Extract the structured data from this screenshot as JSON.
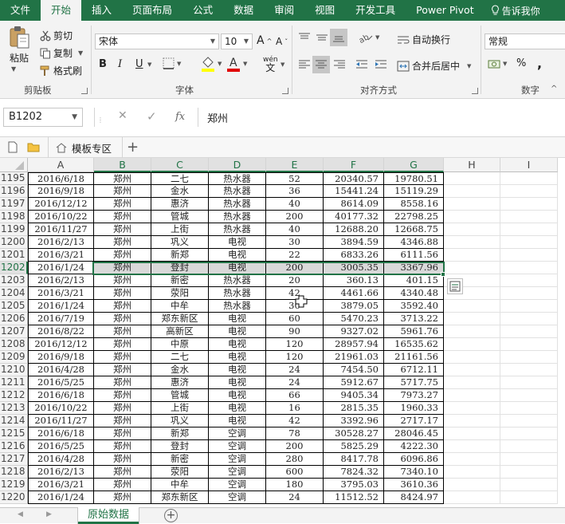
{
  "ribbon_tabs": [
    "文件",
    "开始",
    "插入",
    "页面布局",
    "公式",
    "数据",
    "审阅",
    "视图",
    "开发工具",
    "Power Pivot"
  ],
  "active_tab": "开始",
  "tell_me": "告诉我你",
  "clipboard": {
    "paste": "粘贴",
    "cut": "剪切",
    "copy": "复制",
    "format_painter": "格式刷",
    "label": "剪贴板"
  },
  "font": {
    "name": "宋体",
    "size": "10",
    "bold": "B",
    "italic": "I",
    "underline": "U",
    "wen": "wén",
    "label": "字体"
  },
  "alignment": {
    "wrap": "自动换行",
    "merge": "合并后居中",
    "label": "对齐方式"
  },
  "number": {
    "format": "常规",
    "label": "数字",
    "percent": "%",
    "comma": ","
  },
  "formula_bar": {
    "name_box": "B1202",
    "fx": "fx",
    "value": "郑州"
  },
  "tab_bar": {
    "template_label": "模板专区",
    "add": "+"
  },
  "columns": [
    "A",
    "B",
    "C",
    "D",
    "E",
    "F",
    "G",
    "H",
    "I"
  ],
  "selected_row": 1202,
  "rows": [
    {
      "n": 1195,
      "a": "2016/6/18",
      "b": "郑州",
      "c": "二七",
      "d": "热水器",
      "e": "52",
      "f": "20340.57",
      "g": "19780.51"
    },
    {
      "n": 1196,
      "a": "2016/9/18",
      "b": "郑州",
      "c": "金水",
      "d": "热水器",
      "e": "36",
      "f": "15441.24",
      "g": "15119.29"
    },
    {
      "n": 1197,
      "a": "2016/12/12",
      "b": "郑州",
      "c": "惠济",
      "d": "热水器",
      "e": "40",
      "f": "8614.09",
      "g": "8558.16"
    },
    {
      "n": 1198,
      "a": "2016/10/22",
      "b": "郑州",
      "c": "管城",
      "d": "热水器",
      "e": "200",
      "f": "40177.32",
      "g": "22798.25"
    },
    {
      "n": 1199,
      "a": "2016/11/27",
      "b": "郑州",
      "c": "上街",
      "d": "热水器",
      "e": "40",
      "f": "12688.20",
      "g": "12668.75"
    },
    {
      "n": 1200,
      "a": "2016/2/13",
      "b": "郑州",
      "c": "巩义",
      "d": "电视",
      "e": "30",
      "f": "3894.59",
      "g": "4346.88"
    },
    {
      "n": 1201,
      "a": "2016/3/21",
      "b": "郑州",
      "c": "新郑",
      "d": "电视",
      "e": "22",
      "f": "6833.26",
      "g": "6111.56"
    },
    {
      "n": 1202,
      "a": "2016/1/24",
      "b": "郑州",
      "c": "登封",
      "d": "电视",
      "e": "200",
      "f": "3005.35",
      "g": "3367.96"
    },
    {
      "n": 1203,
      "a": "2016/2/13",
      "b": "郑州",
      "c": "新密",
      "d": "热水器",
      "e": "20",
      "f": "360.13",
      "g": "401.15"
    },
    {
      "n": 1204,
      "a": "2016/3/21",
      "b": "郑州",
      "c": "荥阳",
      "d": "热水器",
      "e": "42",
      "f": "4461.66",
      "g": "4340.48"
    },
    {
      "n": 1205,
      "a": "2016/1/24",
      "b": "郑州",
      "c": "中牟",
      "d": "热水器",
      "e": "30",
      "f": "3879.05",
      "g": "3592.40"
    },
    {
      "n": 1206,
      "a": "2016/7/19",
      "b": "郑州",
      "c": "郑东新区",
      "d": "电视",
      "e": "60",
      "f": "5470.23",
      "g": "3713.22"
    },
    {
      "n": 1207,
      "a": "2016/8/22",
      "b": "郑州",
      "c": "高新区",
      "d": "电视",
      "e": "90",
      "f": "9327.02",
      "g": "5961.76"
    },
    {
      "n": 1208,
      "a": "2016/12/12",
      "b": "郑州",
      "c": "中原",
      "d": "电视",
      "e": "120",
      "f": "28957.94",
      "g": "16535.62"
    },
    {
      "n": 1209,
      "a": "2016/9/18",
      "b": "郑州",
      "c": "二七",
      "d": "电视",
      "e": "120",
      "f": "21961.03",
      "g": "21161.56"
    },
    {
      "n": 1210,
      "a": "2016/4/28",
      "b": "郑州",
      "c": "金水",
      "d": "电视",
      "e": "24",
      "f": "7454.50",
      "g": "6712.11"
    },
    {
      "n": 1211,
      "a": "2016/5/25",
      "b": "郑州",
      "c": "惠济",
      "d": "电视",
      "e": "24",
      "f": "5912.67",
      "g": "5717.75"
    },
    {
      "n": 1212,
      "a": "2016/6/18",
      "b": "郑州",
      "c": "管城",
      "d": "电视",
      "e": "66",
      "f": "9405.34",
      "g": "7973.27"
    },
    {
      "n": 1213,
      "a": "2016/10/22",
      "b": "郑州",
      "c": "上街",
      "d": "电视",
      "e": "16",
      "f": "2815.35",
      "g": "1960.33"
    },
    {
      "n": 1214,
      "a": "2016/11/27",
      "b": "郑州",
      "c": "巩义",
      "d": "电视",
      "e": "42",
      "f": "3392.96",
      "g": "2717.17"
    },
    {
      "n": 1215,
      "a": "2016/6/18",
      "b": "郑州",
      "c": "新郑",
      "d": "空调",
      "e": "78",
      "f": "30528.27",
      "g": "28046.45"
    },
    {
      "n": 1216,
      "a": "2016/5/25",
      "b": "郑州",
      "c": "登封",
      "d": "空调",
      "e": "200",
      "f": "5825.29",
      "g": "4222.30"
    },
    {
      "n": 1217,
      "a": "2016/4/28",
      "b": "郑州",
      "c": "新密",
      "d": "空调",
      "e": "280",
      "f": "8417.78",
      "g": "6096.86"
    },
    {
      "n": 1218,
      "a": "2016/2/13",
      "b": "郑州",
      "c": "荥阳",
      "d": "空调",
      "e": "600",
      "f": "7824.32",
      "g": "7340.10"
    },
    {
      "n": 1219,
      "a": "2016/3/21",
      "b": "郑州",
      "c": "中牟",
      "d": "空调",
      "e": "180",
      "f": "3795.03",
      "g": "3610.36"
    },
    {
      "n": 1220,
      "a": "2016/1/24",
      "b": "郑州",
      "c": "郑东新区",
      "d": "空调",
      "e": "24",
      "f": "11512.52",
      "g": "8424.97"
    }
  ],
  "sheet_tabs": [
    "原始数据"
  ],
  "add_sheet": "+",
  "colors": {
    "excel_green": "#217346",
    "ribbon_bg": "#f3f3f3",
    "highlight_row": "#d9d9d9"
  }
}
